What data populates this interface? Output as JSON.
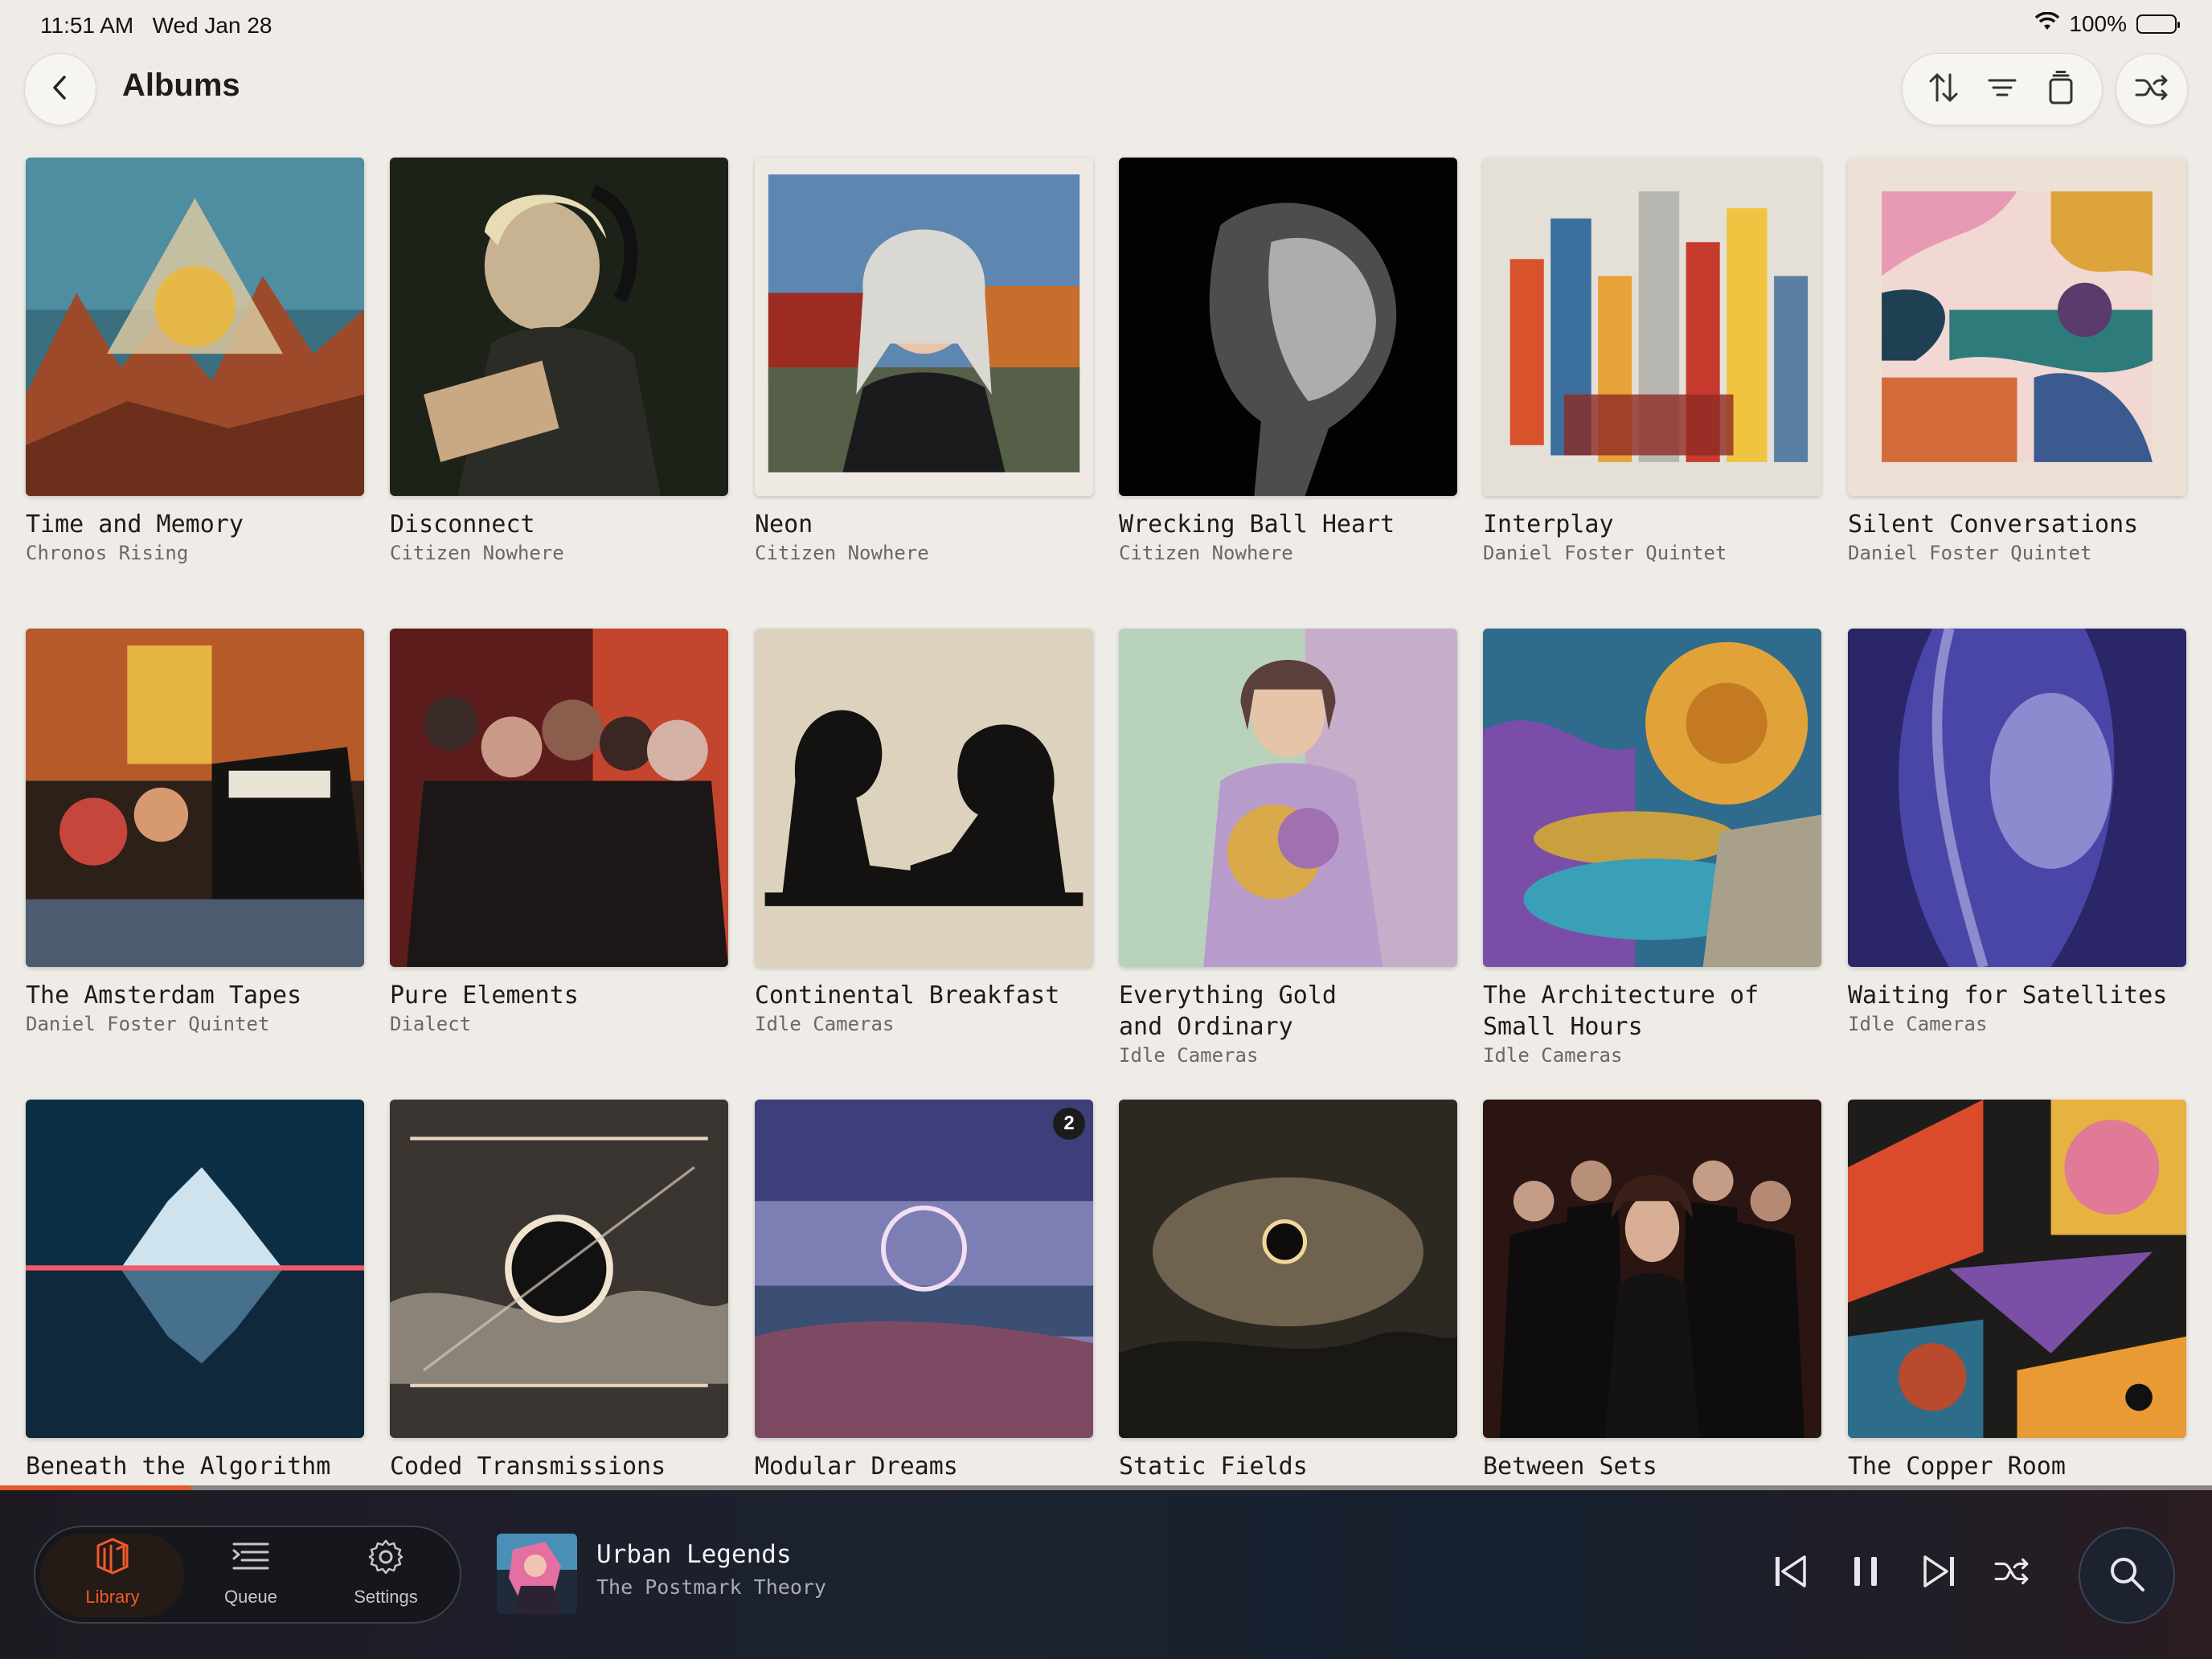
{
  "status_bar": {
    "time": "11:51 AM",
    "date": "Wed Jan 28",
    "battery": "100%",
    "wifi_icon": "wifi-icon",
    "battery_icon": "battery-icon"
  },
  "header": {
    "title": "Albums",
    "back_icon": "chevron-left-icon",
    "toolbar_icons": [
      "sort-icon",
      "filter-icon",
      "layers-icon"
    ],
    "shuffle_icon": "shuffle-icon"
  },
  "albums": [
    {
      "title": "Time and Memory",
      "artist": "Chronos Rising"
    },
    {
      "title": "Disconnect",
      "artist": "Citizen Nowhere"
    },
    {
      "title": "Neon",
      "artist": "Citizen Nowhere"
    },
    {
      "title": "Wrecking Ball Heart",
      "artist": "Citizen Nowhere"
    },
    {
      "title": "Interplay",
      "artist": "Daniel Foster Quintet"
    },
    {
      "title": "Silent Conversations",
      "artist": "Daniel Foster Quintet"
    },
    {
      "title": "The Amsterdam Tapes",
      "artist": "Daniel Foster Quintet"
    },
    {
      "title": "Pure Elements",
      "artist": "Dialect"
    },
    {
      "title": "Continental Breakfast",
      "artist": "Idle Cameras"
    },
    {
      "title": "Everything Gold\nand Ordinary",
      "artist": "Idle Cameras"
    },
    {
      "title": "The Architecture of\nSmall Hours",
      "artist": "Idle Cameras"
    },
    {
      "title": "Waiting for Satellites",
      "artist": "Idle Cameras"
    },
    {
      "title": "Beneath the Algorithm",
      "artist": ""
    },
    {
      "title": "Coded Transmissions",
      "artist": ""
    },
    {
      "title": "Modular Dreams",
      "artist": "",
      "badge": "2"
    },
    {
      "title": "Static Fields",
      "artist": ""
    },
    {
      "title": "Between Sets",
      "artist": ""
    },
    {
      "title": "The Copper Room",
      "artist": ""
    }
  ],
  "now_playing": {
    "title": "Urban Legends",
    "artist": "The Postmark Theory",
    "progress": 0.086
  },
  "tabs": [
    {
      "label": "Library",
      "icon": "library-icon",
      "active": true
    },
    {
      "label": "Queue",
      "icon": "queue-icon",
      "active": false
    },
    {
      "label": "Settings",
      "icon": "gear-icon",
      "active": false
    }
  ],
  "controls": [
    "skip-back-icon",
    "pause-icon",
    "skip-forward-icon",
    "shuffle-icon"
  ],
  "colors": {
    "accent": "#ee5b2b",
    "background": "#efece7",
    "player": "#1c2230"
  }
}
